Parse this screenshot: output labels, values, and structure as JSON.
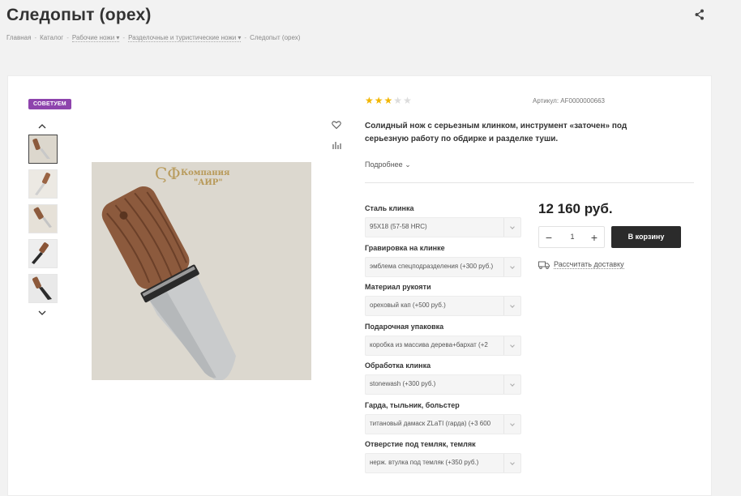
{
  "page": {
    "title": "Следопыт (орех)"
  },
  "breadcrumb": [
    {
      "label": "Главная"
    },
    {
      "label": "Каталог"
    },
    {
      "label": "Рабочие ножи"
    },
    {
      "label": "Разделочные и туристические ножи"
    },
    {
      "label": "Следопыт (орех)"
    }
  ],
  "badge": "СОВЕТУЕМ",
  "rating": {
    "value": 3,
    "max": 5
  },
  "sku": "Артикул: AF0000000663",
  "description": "Солидный нож с серьезным клинком, инструмент «заточен» под серьезную работу по обдирке и разделке туши.",
  "more_label": "Подробнее",
  "options": [
    {
      "label": "Сталь клинка",
      "value": "95Х18 (57-58 HRC)"
    },
    {
      "label": "Гравировка на клинке",
      "value": "эмблема спецподразделения (+300 руб.)"
    },
    {
      "label": "Материал рукояти",
      "value": "ореховый кап (+500 руб.)"
    },
    {
      "label": "Подарочная упаковка",
      "value": "коробка из массива дерева+бархат (+2"
    },
    {
      "label": "Обработка клинка",
      "value": "stonewash (+300 руб.)"
    },
    {
      "label": "Гарда, тыльник, больстер",
      "value": "титановый дамаск ZLaTI (гарда) (+3 600"
    },
    {
      "label": "Отверстие под темляк, темляк",
      "value": "нерж. втулка под темляк (+350 руб.)"
    }
  ],
  "price": "12 160 руб.",
  "quantity": "1",
  "cart_button": "В корзину",
  "delivery_link": "Рассчитать доставку",
  "image_logo": "Компания АИР",
  "colors": {
    "accent_badge": "#8e44ad",
    "star": "#f2b600",
    "button": "#2b2b2b"
  },
  "icons": [
    "share-icon",
    "heart-icon",
    "compare-icon",
    "chevron-up-icon",
    "chevron-down-icon",
    "truck-icon"
  ]
}
